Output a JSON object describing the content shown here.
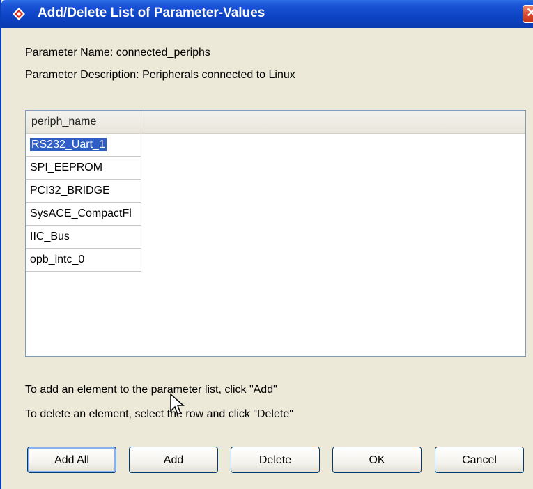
{
  "window": {
    "title": "Add/Delete List of Parameter-Values",
    "close_label": "✕"
  },
  "info": {
    "param_name": "Parameter Name: connected_periphs",
    "param_desc": "Parameter Description: Peripherals connected to Linux"
  },
  "table": {
    "column_header": "periph_name",
    "rows": [
      "RS232_Uart_1",
      "SPI_EEPROM",
      "PCI32_BRIDGE",
      "SysACE_CompactFl",
      "IIC_Bus",
      "opb_intc_0"
    ],
    "selected_index": 0
  },
  "help": {
    "add_line": "To add an element to the parameter list, click \"Add\"",
    "delete_line": "To delete an element, select the row and click \"Delete\""
  },
  "buttons": {
    "add_all": "Add All",
    "add": "Add",
    "delete": "Delete",
    "ok": "OK",
    "cancel": "Cancel"
  },
  "colors": {
    "titlebar": "#0d43c4",
    "selection": "#2f5fc4",
    "dialog_bg": "#ece9d8"
  }
}
